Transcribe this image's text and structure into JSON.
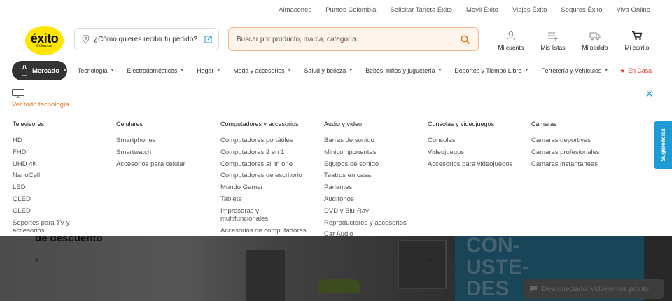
{
  "top_links": [
    "Almacenes",
    "Puntos Colombia",
    "Solicitar Tarjeta Éxito",
    "Movil Éxito",
    "Viajes Éxito",
    "Seguros Éxito",
    "Viva Online"
  ],
  "logo": {
    "brand": "éxito",
    "sub": "Colombia",
    "color": "#ffe600"
  },
  "location": {
    "label": "¿Cómo quieres recibir tu pedido?",
    "icon": "location-pin-icon",
    "edit_icon": "edit-icon"
  },
  "search": {
    "placeholder": "Buscar por producto, marca, categoría...",
    "icon": "search-icon",
    "accent": "#e87722"
  },
  "header_actions": [
    {
      "label": "Mi cuenta",
      "icon": "user-icon"
    },
    {
      "label": "Mis listas",
      "icon": "list-icon"
    },
    {
      "label": "Mi pedido",
      "icon": "truck-icon"
    },
    {
      "label": "Mi carrito",
      "icon": "cart-icon"
    }
  ],
  "category_nav": {
    "active": "Mercado",
    "items": [
      "Tecnología",
      "Electrodomésticos",
      "Hogar",
      "Moda y accesorios",
      "Salud y belleza",
      "Bebés, niños y juguetería",
      "Deportes y Tiempo Libre",
      "Ferretería y Vehículos"
    ],
    "encasa": "En Casa",
    "encasa_color": "#e4352b"
  },
  "dropdown": {
    "ver_todo": "Ver todo tecnología",
    "columns": [
      {
        "title": "Televisores",
        "items": [
          "HD",
          "FHD",
          "UHD 4K",
          "NanoCell",
          "LED",
          "QLED",
          "OLED",
          "Soportes para TV y accesorios"
        ]
      },
      {
        "title": "Celulares",
        "items": [
          "Smartphones",
          "Smartwatch",
          "Accesorios para celular"
        ]
      },
      {
        "title": "Computadores y accesorios",
        "items": [
          "Computadores portátiles",
          "Computadores 2 en 1",
          "Computadores all in one",
          "Computadores de escritorio",
          "Mundo Gamer",
          "Tablets",
          "Impresoras y multifuncionales",
          "Accesorios de computadores"
        ]
      },
      {
        "title": "Audio y video",
        "items": [
          "Barras de sonido",
          "Minicomponentes",
          "Equipos de sonido",
          "Teatros en casa",
          "Parlantes",
          "Audífonos",
          "DVD y Blu-Ray",
          "Reproductores y accesorios",
          "Car Audio"
        ]
      },
      {
        "title": "Consolas y videojuegos",
        "items": [
          "Consolas",
          "Videojuegos",
          "Accesorios para videojuegos"
        ]
      },
      {
        "title": "Cámaras",
        "items": [
          "Camaras deportivas",
          "Camaras profesionales",
          "Camaras instantaneas"
        ]
      }
    ]
  },
  "hero": {
    "promo_text": "de descuento",
    "side_text": "CON-\nUSTE-\nDES"
  },
  "chat_widget": {
    "label": "Desconectado: Volveremos pronto"
  },
  "sugerencias": "Sugerencias"
}
